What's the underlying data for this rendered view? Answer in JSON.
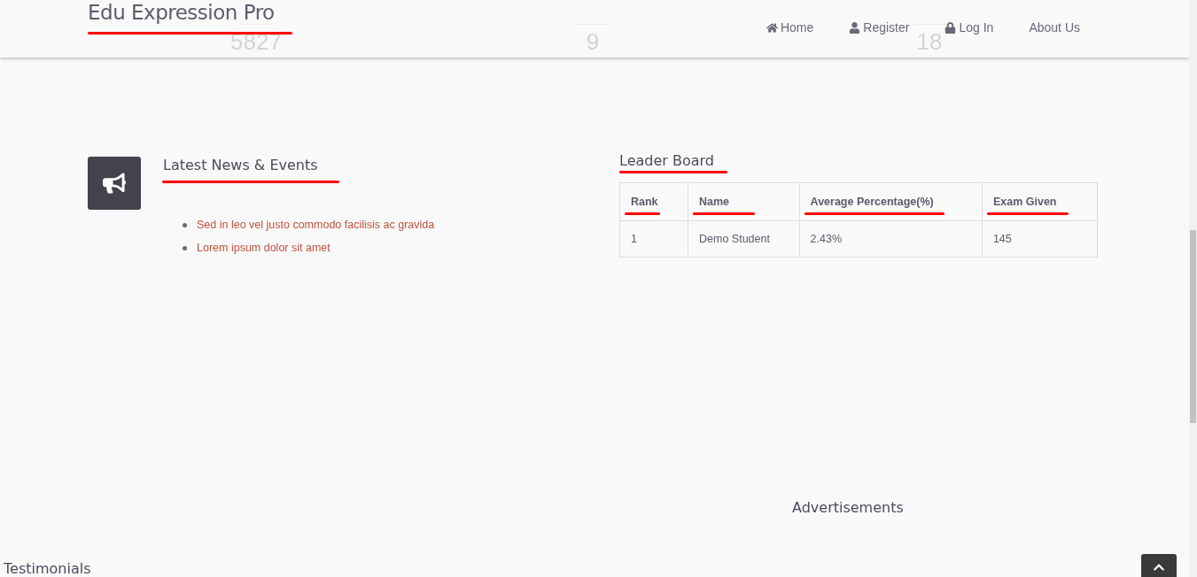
{
  "header": {
    "brand": "Edu Expression Pro",
    "nav": [
      {
        "label": "Home"
      },
      {
        "label": "Register"
      },
      {
        "label": "Log In"
      },
      {
        "label": "About Us"
      }
    ]
  },
  "stats": [
    {
      "value": "5827"
    },
    {
      "value": "9"
    },
    {
      "value": "18"
    }
  ],
  "news": {
    "title": "Latest News & Events",
    "items": [
      "Sed in leo vel justo commodo facilisis ac gravida",
      "Lorem ipsum dolor sit amet"
    ]
  },
  "leader_board": {
    "title": "Leader Board",
    "columns": [
      "Rank",
      "Name",
      "Average Percentage(%)",
      "Exam Given"
    ],
    "rows": [
      [
        "1",
        "Demo Student",
        "2.43%",
        "145"
      ]
    ]
  },
  "advertisements": {
    "title": "Advertisements"
  },
  "testimonials": {
    "title": "Testimonials"
  }
}
